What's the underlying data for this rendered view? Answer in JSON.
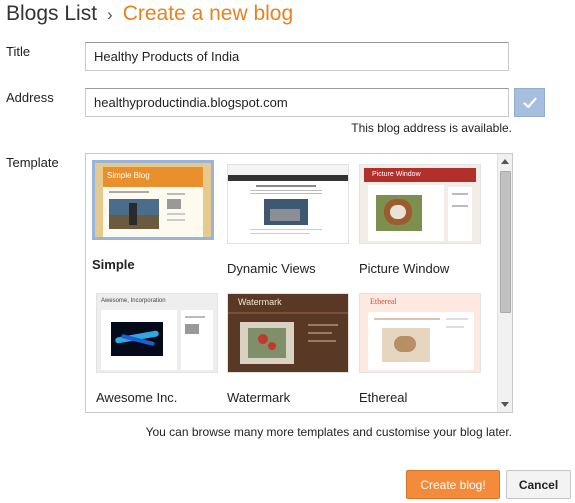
{
  "header": {
    "breadcrumb": "Blogs List",
    "separator": "›",
    "title": "Create a new blog"
  },
  "form": {
    "title_label": "Title",
    "title_value": "Healthy Products of India",
    "address_label": "Address",
    "address_value": "healthyproductindia.blogspot.com",
    "address_status": "This blog address is available.",
    "template_label": "Template"
  },
  "templates": [
    {
      "name": "Simple",
      "selected": true
    },
    {
      "name": "Dynamic Views",
      "selected": false
    },
    {
      "name": "Picture Window",
      "selected": false
    },
    {
      "name": "Awesome Inc.",
      "selected": false
    },
    {
      "name": "Watermark",
      "selected": false
    },
    {
      "name": "Ethereal",
      "selected": false
    }
  ],
  "thumb_text": {
    "simple": "Simple Blog",
    "picture_window": "Picture Window",
    "awesome": "Awesome, Incorporation",
    "watermark": "Watermark",
    "ethereal": "Ethereal"
  },
  "footer_note": "You can browse many more templates and customise your blog later.",
  "buttons": {
    "create": "Create blog!",
    "cancel": "Cancel"
  },
  "colors": {
    "accent": "#e8821e",
    "primary_button": "#f48b3b",
    "check_button": "#a6bfde",
    "selected_border": "#9ab3db"
  }
}
